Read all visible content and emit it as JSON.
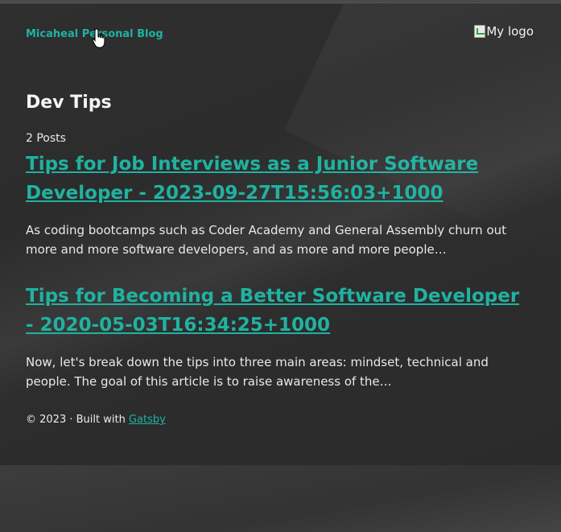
{
  "header": {
    "site_title": "Micaheal Personal Blog",
    "logo_alt": "My logo"
  },
  "main": {
    "tag_title": "Dev Tips",
    "post_count": "2 Posts",
    "posts": [
      {
        "title": "Tips for Job Interviews as a Junior Software Developer - 2023-09-27T15:56:03+1000",
        "excerpt": "As coding bootcamps such as Coder Academy and General Assembly churn out more and more software developers, and as more and more people…"
      },
      {
        "title": "Tips for Becoming a Better Software Developer - 2020-05-03T16:34:25+1000",
        "excerpt": "Now, let's break down the tips into three main areas: mindset, technical and people. The goal of this article is to raise awareness of the…"
      }
    ]
  },
  "footer": {
    "text": "© 2023 · Built with",
    "link_label": "Gatsby"
  },
  "colors": {
    "accent": "#20b2a1",
    "background": "#2d2d2d",
    "text": "#ececec"
  },
  "icons": {
    "cursor": "hand-pointer-icon",
    "broken_image": "broken-image-icon"
  }
}
